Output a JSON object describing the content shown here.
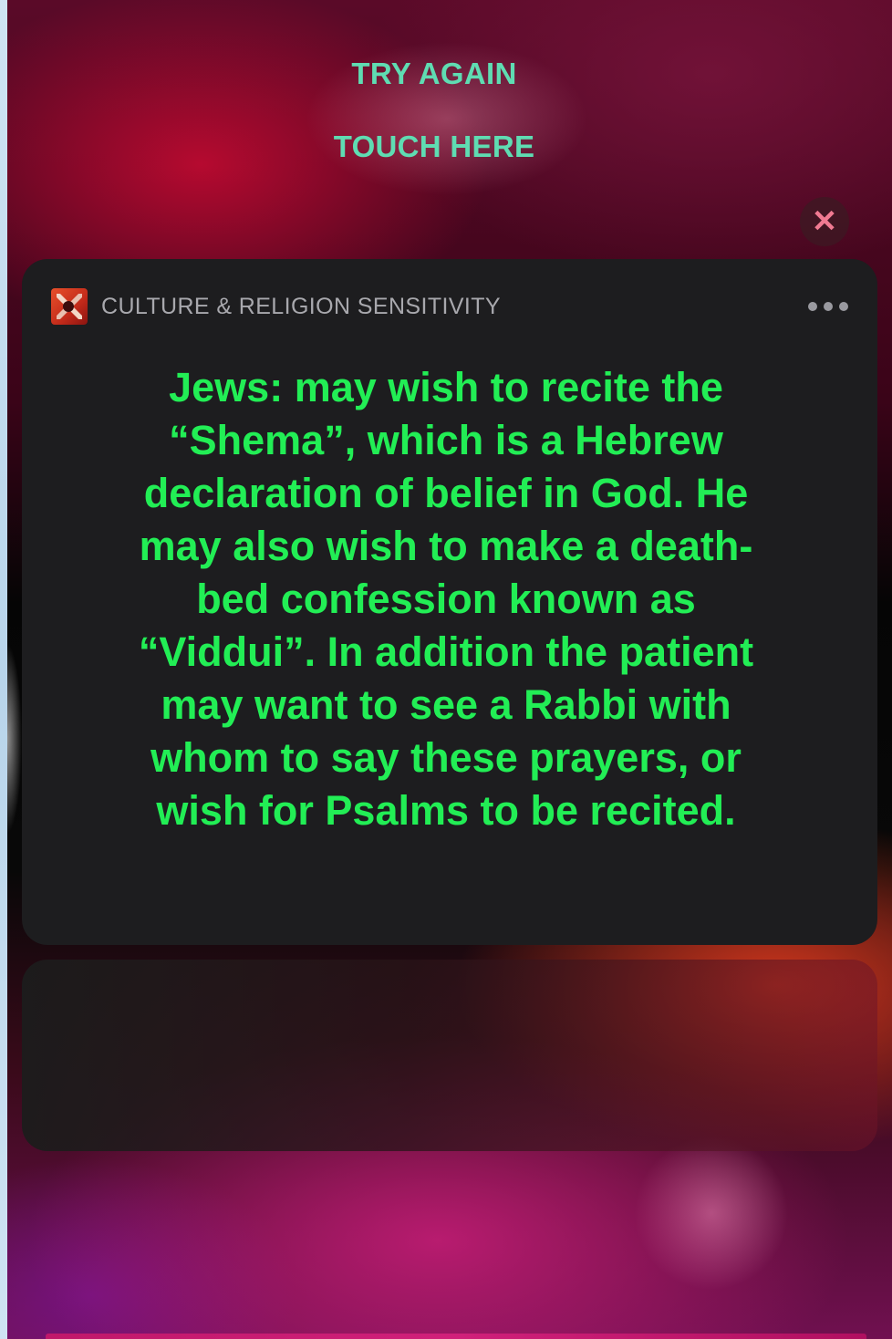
{
  "top": {
    "try_again_label": "TRY AGAIN",
    "touch_here_label": "TOUCH HERE",
    "close_icon": "close-icon"
  },
  "notification": {
    "app_icon": "app-icon",
    "app_title": "CULTURE & RELIGION SENSITIVITY",
    "more_icon": "more-options-icon",
    "message": "Jews: may wish to recite the “Shema”, which is a Hebrew declaration of belief in God. He may also wish to make a death-bed confession known as “Viddui”. In addition the patient may want to see a Rabbi with whom to say these prayers, or wish for Psalms to be recited."
  },
  "colors": {
    "link": "#5fdcb2",
    "message_text": "#22ee55",
    "card_background": "#1d1d1f",
    "close_icon": "#f07a92"
  }
}
